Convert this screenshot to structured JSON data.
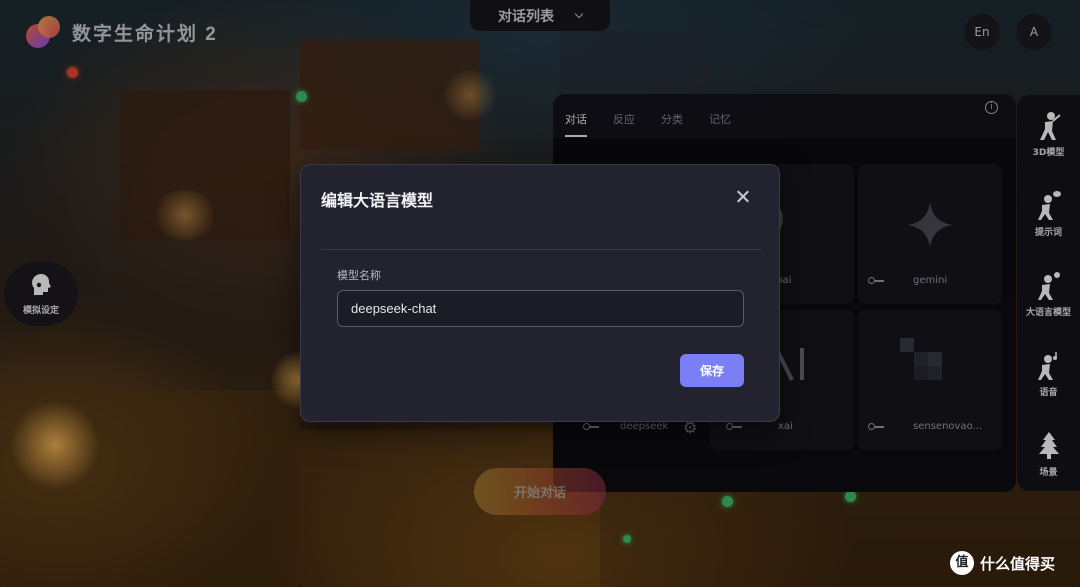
{
  "app": {
    "title": "数字生命计划 2"
  },
  "header": {
    "chat_list_label": "对话列表",
    "lang_button": "En",
    "avatar_button": "A"
  },
  "left_float": {
    "label": "模拟设定"
  },
  "panel": {
    "tabs": [
      {
        "label": "对话",
        "active": true
      },
      {
        "label": "反应",
        "active": false
      },
      {
        "label": "分类",
        "active": false
      },
      {
        "label": "记忆",
        "active": false
      }
    ],
    "models": [
      {
        "name": "enai"
      },
      {
        "name": "gemini"
      },
      {
        "name": "deepseek"
      },
      {
        "name": "xai"
      },
      {
        "name": "sensenovao..."
      }
    ]
  },
  "right_sidebar": {
    "items": [
      {
        "label": "3D模型"
      },
      {
        "label": "提示词"
      },
      {
        "label": "大语言模型"
      },
      {
        "label": "语音"
      },
      {
        "label": "场景"
      }
    ]
  },
  "start_button": {
    "label": "开始对话"
  },
  "modal": {
    "title": "编辑大语言模型",
    "field_label": "模型名称",
    "field_value": "deepseek-chat",
    "save_label": "保存"
  },
  "watermark": {
    "mark": "值",
    "text": "什么值得买"
  },
  "colors": {
    "accent": "#7b7ff6",
    "panel_bg": "#23232f"
  }
}
